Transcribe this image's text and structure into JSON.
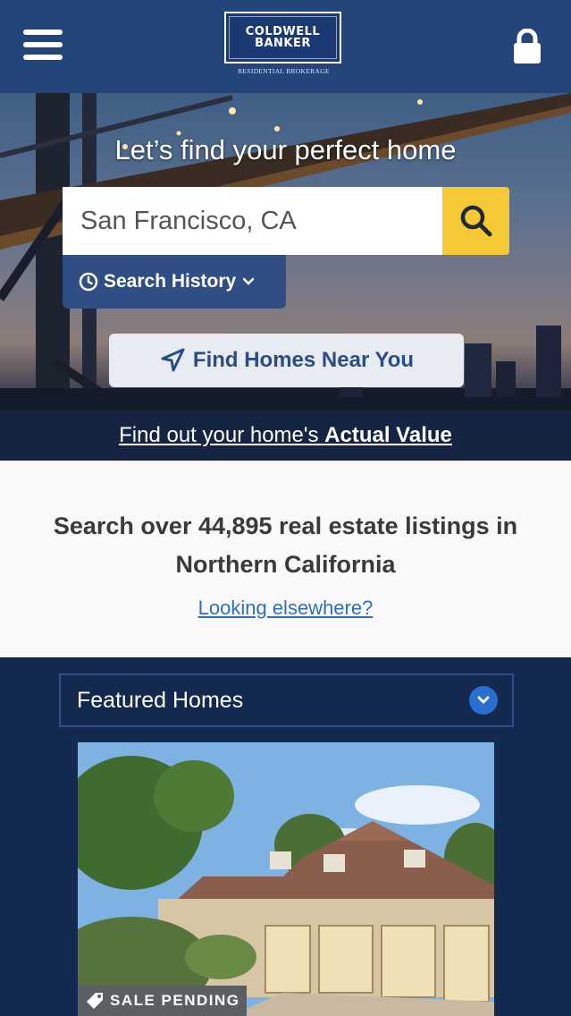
{
  "header": {
    "logo_line1": "COLDWELL",
    "logo_line2": "BANKER",
    "logo_subtitle": "RESIDENTIAL BROKERAGE",
    "menu_icon": "hamburger-menu-icon",
    "lock_icon": "lock-icon"
  },
  "hero": {
    "title": "Let’s find your perfect home",
    "search_placeholder": "San Francisco, CA",
    "search_icon": "search-icon",
    "search_history_label": "Search History",
    "find_near_label": "Find Homes Near You",
    "value_prefix": "Find out your home's ",
    "value_bold": "Actual Value"
  },
  "info": {
    "listings_text": "Search over 44,895 real estate listings in Northern California",
    "elsewhere_link": "Looking elsewhere?"
  },
  "featured": {
    "selected": "Featured Homes",
    "badge": "SALE PENDING"
  },
  "colors": {
    "header_bg": "#24457a",
    "page_bg": "#14294f",
    "search_button": "#f5c935",
    "link_blue": "#2f6fbf"
  }
}
